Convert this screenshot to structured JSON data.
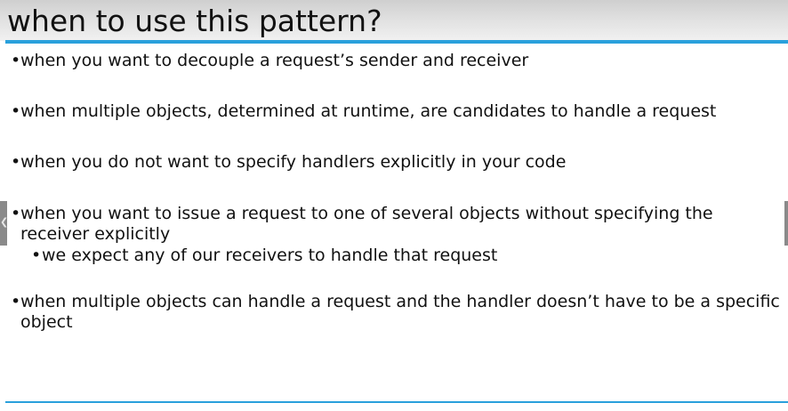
{
  "slide": {
    "title": "when to use this pattern?",
    "bullet_glyph": "•",
    "bullets": [
      {
        "text": "when you want to decouple a request’s sender and receiver"
      },
      {
        "text": "when multiple objects, determined at runtime, are candidates to handle a request"
      },
      {
        "text": "when you do not want to specify handlers explicitly in your code"
      },
      {
        "text": "when you want to issue a request to one of several objects without specifying the",
        "continuation": "receiver explicitly",
        "sub_bullets": [
          {
            "text": "we expect any of our receivers to handle that request"
          }
        ]
      },
      {
        "text": "when multiple objects can handle a request and the handler doesn’t have to be a specific",
        "continuation": "object"
      }
    ]
  },
  "colors": {
    "accent_rule": "#2aa0dc",
    "header_band": "#cfcfcf",
    "text": "#111111"
  },
  "icons": {
    "left_nav": "chevron-left-icon",
    "right_nav": "edge-handle"
  }
}
